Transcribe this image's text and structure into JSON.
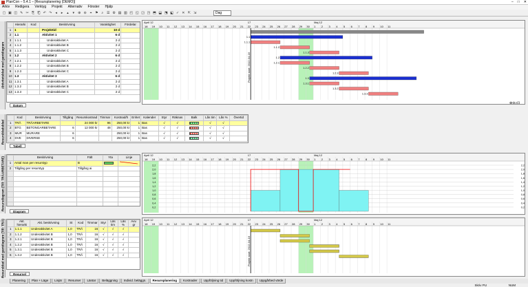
{
  "window": {
    "title": "PlanCon – 5.4.1 – [Resursplanering (DEMO)]",
    "min": "–",
    "max": "□",
    "close": "✕"
  },
  "menu": [
    "Arkiv",
    "Redigera",
    "Verktyg",
    "Projekt",
    "Alternativ",
    "Fönster",
    "Hjälp"
  ],
  "toolbar": {
    "zoom": "Dag"
  },
  "timeline": {
    "top_left": "April 12",
    "top_right": "Maj 12",
    "mid": "17",
    "days": [
      "18",
      "19",
      "10",
      "11",
      "12",
      "13",
      "14",
      "15",
      "16",
      "17",
      "18",
      "19",
      "20",
      "21",
      "22",
      "23",
      "24",
      "25",
      "26",
      "27",
      "28",
      "29",
      "30",
      "1",
      "2",
      "3",
      "4",
      "5",
      "6",
      "7",
      "8",
      "9",
      "10",
      "11"
    ]
  },
  "panels": {
    "aktivitet": "Aktivitetsblad med gantdiagram",
    "resurs": "Resursbladsblad",
    "resursdiagram": "Resursdiagram (Till: TRÄARBETARE)",
    "resursblad_gant": "Resursblad med gantdiagram (Till: TRÄ)"
  },
  "activity_grid": {
    "headers": [
      "",
      "Hierarki",
      "Kod",
      "Beskrivning",
      "Varaktighet",
      "Fördelar"
    ],
    "rows": [
      {
        "n": "1",
        "h": "1",
        "k": "",
        "d": "Projekttid",
        "v": "10 d",
        "f": "",
        "hl": true,
        "bold": true
      },
      {
        "n": "2",
        "h": "1.1",
        "k": "",
        "d": "Aktivitet 1",
        "v": "6 d",
        "f": "",
        "bold": true
      },
      {
        "n": "3",
        "h": "1.1.1",
        "k": "",
        "d": "Underaktivitet A",
        "v": "2 d",
        "f": ""
      },
      {
        "n": "4",
        "h": "1.1.2",
        "k": "",
        "d": "Underaktivitet B",
        "v": "2 d",
        "f": ""
      },
      {
        "n": "5",
        "h": "1.1.3",
        "k": "",
        "d": "Underaktivitet C",
        "v": "2 d",
        "f": ""
      },
      {
        "n": "6",
        "h": "1.2",
        "k": "",
        "d": "Aktivitet 2",
        "v": "6 d",
        "f": "",
        "bold": true
      },
      {
        "n": "7",
        "h": "1.2.1",
        "k": "",
        "d": "Underaktivitet A",
        "v": "2 d",
        "f": ""
      },
      {
        "n": "8",
        "h": "1.2.2",
        "k": "",
        "d": "Underaktivitet B",
        "v": "2 d",
        "f": ""
      },
      {
        "n": "9",
        "h": "1.2.3",
        "k": "",
        "d": "Underaktivitet C",
        "v": "2 d",
        "f": ""
      },
      {
        "n": "10",
        "h": "1.3",
        "k": "",
        "d": "Aktivitet 3",
        "v": "6 d",
        "f": "",
        "bold": true
      },
      {
        "n": "11",
        "h": "1.3.1",
        "k": "",
        "d": "Underaktivitet A",
        "v": "2 d",
        "f": ""
      },
      {
        "n": "12",
        "h": "1.3.2",
        "k": "",
        "d": "Underaktivitet B",
        "v": "2 d",
        "f": ""
      },
      {
        "n": "13",
        "h": "1.3.3",
        "k": "",
        "d": "Underaktivitet C",
        "v": "2 d",
        "f": ""
      }
    ],
    "tab": "Datum"
  },
  "gantt_labels": [
    "1.1",
    "1.1.1",
    "1.1.2",
    "1.1.3",
    "1.2",
    "1.2.1",
    "1.2.2",
    "1.2.3",
    "1.3",
    "1.3.1",
    "1.3.2",
    "1.3.3"
  ],
  "project_start": "Projekt start: 2012-04-16",
  "resource_grid": {
    "headers": [
      "",
      "Kod",
      "Beskrivning",
      "Tillgång",
      "Resurskostnad",
      "Timmar",
      "Kostnad/h",
      "Enhet",
      "Kalender",
      "Styr",
      "Räknas",
      "Balk",
      "Lås tim",
      "Lås %",
      "Övertid"
    ],
    "rows": [
      {
        "n": "1",
        "k": "TRÄ",
        "d": "TRÄARBETARE",
        "t": "",
        "rk": "24 000 kr",
        "tim": "96",
        "kh": "250,00 kr",
        "e": "1",
        "kal": "Bas",
        "hl": true,
        "col": "#2ecc40"
      },
      {
        "n": "2",
        "k": "BTG",
        "d": "BETONGARBETARE",
        "t": "6",
        "rk": "12 000 kr",
        "tim": "48",
        "kh": "250,00 kr",
        "e": "1",
        "kal": "Bas",
        "col": "#e74c3c"
      },
      {
        "n": "3",
        "k": "MUR",
        "d": "MURARE",
        "t": "6",
        "rk": "",
        "tim": "",
        "kh": "250,00 kr",
        "e": "1",
        "kal": "Bas",
        "col": "#e74c3c"
      },
      {
        "n": "4",
        "k": "DVE",
        "d": "DIVERSE",
        "t": "6",
        "rk": "",
        "tim": "",
        "kh": "250,00 kr",
        "e": "1",
        "kal": "Bas",
        "col": "#27ae60"
      }
    ],
    "check": "√",
    "tab": "Tabell"
  },
  "diagram_legend": {
    "headers": [
      "",
      "Beskrivning",
      "Fält",
      "Yta",
      "Linje"
    ],
    "rows": [
      {
        "n": "1",
        "d": "Antal man per resurstyp",
        "f": "B",
        "hl": true
      },
      {
        "n": "2",
        "d": "Tillgång per resurstyp",
        "f": "Tillgång ai"
      }
    ],
    "tab": "Diagram"
  },
  "diagram_axis": [
    "2,2",
    "2,0",
    "1,8",
    "1,6",
    "1,4",
    "1,2",
    "1,0",
    "0,8",
    "0,6",
    "0,4",
    "0,2"
  ],
  "diagram_axis_right": [
    "2,2",
    "2,0",
    "1,8",
    "1,6",
    "1,4",
    "1,2",
    "1,0",
    "0,8",
    "0,6",
    "0,4",
    "0,2"
  ],
  "assign_grid": {
    "headers": [
      "",
      "Akt. hierarki",
      "Akt. beskrivning",
      "St",
      "Kod",
      "Timmar",
      "Styr",
      "Lås tim",
      "Lås %",
      "Avv. gr"
    ],
    "rows": [
      {
        "n": "1",
        "h": "1.1.1",
        "d": "Underaktivitet A",
        "st": "1,0",
        "k": "TRÄ",
        "tim": "16",
        "hl": true
      },
      {
        "n": "2",
        "h": "1.1.2",
        "d": "Underaktivitet B",
        "st": "1,0",
        "k": "TRÄ",
        "tim": "16"
      },
      {
        "n": "3",
        "h": "1.2.1",
        "d": "Underaktivitet B",
        "st": "1,0",
        "k": "TRÄ",
        "tim": "16"
      },
      {
        "n": "4",
        "h": "1.2.2",
        "d": "Underaktivitet B",
        "st": "1,0",
        "k": "TRÄ",
        "tim": "16"
      },
      {
        "n": "5",
        "h": "1.3.1",
        "d": "Underaktivitet B",
        "st": "1,0",
        "k": "TRÄ",
        "tim": "16"
      },
      {
        "n": "6",
        "h": "1.3.2",
        "d": "Underaktivitet B",
        "st": "1,0",
        "k": "TRÄ",
        "tim": "16"
      }
    ],
    "check": "√",
    "tab": "Resursel"
  },
  "bottom_tabs": [
    "Planering",
    "Plan + Läge",
    "Linjär",
    "Resurser",
    "Läntar",
    "Beläggning",
    "Individ. beläggn.",
    "Resursplanering",
    "Kostnader",
    "Uppföljning tid",
    "Uppföljning kostn",
    "Uppgårbed värde"
  ],
  "active_tab": "Resursplanering",
  "status": {
    "right": "Skriv PU",
    "far_right": "NUM"
  }
}
